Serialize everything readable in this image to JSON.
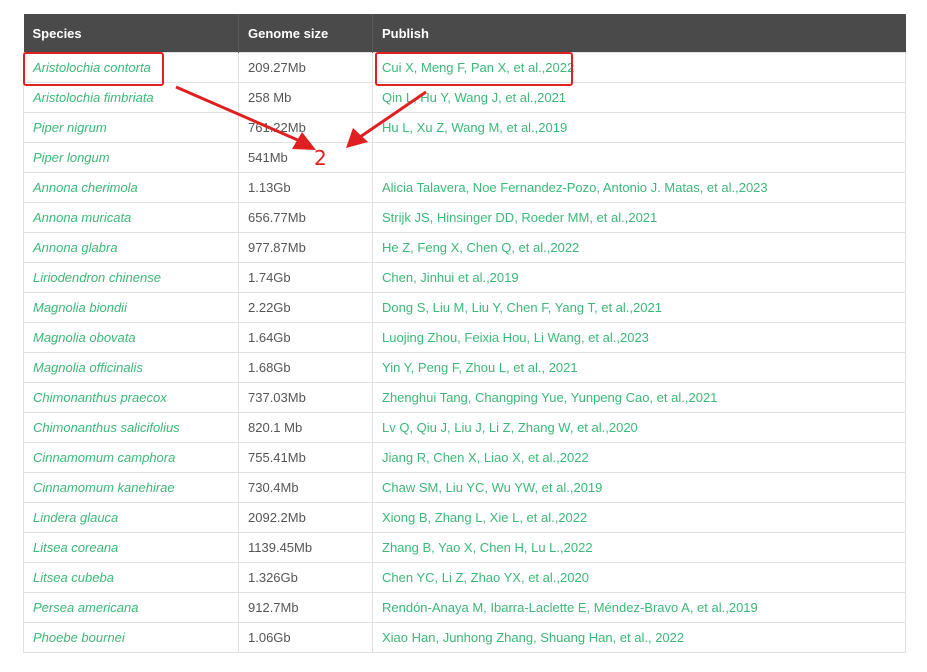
{
  "table": {
    "headers": [
      "Species",
      "Genome size",
      "Publish"
    ],
    "rows": [
      {
        "species": "Aristolochia contorta",
        "size": "209.27Mb",
        "publish": "Cui X, Meng F, Pan X, et al.,2022"
      },
      {
        "species": "Aristolochia fimbriata",
        "size": "258 Mb",
        "publish": "Qin L, Hu Y, Wang J, et al.,2021"
      },
      {
        "species": "Piper nigrum",
        "size": "761.22Mb",
        "publish": "Hu L, Xu Z, Wang M, et al.,2019"
      },
      {
        "species": "Piper longum",
        "size": "541Mb",
        "publish": ""
      },
      {
        "species": "Annona cherimola",
        "size": "1.13Gb",
        "publish": "Alicia Talavera, Noe Fernandez-Pozo, Antonio J. Matas, et al.,2023"
      },
      {
        "species": "Annona muricata",
        "size": "656.77Mb",
        "publish": "Strijk JS, Hinsinger DD, Roeder MM, et al.,2021"
      },
      {
        "species": "Annona glabra",
        "size": "977.87Mb",
        "publish": "He Z, Feng X, Chen Q, et al.,2022"
      },
      {
        "species": "Liriodendron chinense",
        "size": "1.74Gb",
        "publish": "Chen, Jinhui et al.,2019"
      },
      {
        "species": "Magnolia biondii",
        "size": "2.22Gb",
        "publish": "Dong S, Liu M, Liu Y, Chen F, Yang T, et al.,2021"
      },
      {
        "species": "Magnolia obovata",
        "size": "1.64Gb",
        "publish": "Luojing Zhou, Feixia Hou, Li Wang, et al.,2023"
      },
      {
        "species": "Magnolia officinalis",
        "size": "1.68Gb",
        "publish": "Yin Y, Peng F, Zhou L, et al., 2021"
      },
      {
        "species": "Chimonanthus praecox",
        "size": "737.03Mb",
        "publish": "Zhenghui Tang, Changping Yue, Yunpeng Cao, et al.,2021"
      },
      {
        "species": "Chimonanthus salicifolius",
        "size": "820.1 Mb",
        "publish": "Lv Q, Qiu J, Liu J, Li Z, Zhang W, et al.,2020"
      },
      {
        "species": "Cinnamomum camphora",
        "size": "755.41Mb",
        "publish": "Jiang R, Chen X, Liao X, et al.,2022"
      },
      {
        "species": "Cinnamomum kanehirae",
        "size": "730.4Mb",
        "publish": "Chaw SM, Liu YC, Wu YW, et al.,2019"
      },
      {
        "species": "Lindera glauca",
        "size": "2092.2Mb",
        "publish": "Xiong B, Zhang L, Xie L, et al.,2022"
      },
      {
        "species": "Litsea coreana",
        "size": "1139.45Mb",
        "publish": "Zhang B, Yao X, Chen H, Lu L.,2022"
      },
      {
        "species": "Litsea cubeba",
        "size": "1.326Gb",
        "publish": "Chen YC, Li Z, Zhao YX, et al.,2020"
      },
      {
        "species": "Persea americana",
        "size": "912.7Mb",
        "publish": "Rendón-Anaya M, Ibarra-Laclette E, Méndez-Bravo A, et al.,2019"
      },
      {
        "species": "Phoebe bournei",
        "size": "1.06Gb",
        "publish": "Xiao Han, Junhong Zhang, Shuang Han, et al., 2022"
      }
    ]
  },
  "annotation": {
    "label": "2",
    "color": "#e02020"
  },
  "colors": {
    "header_bg": "#4a4a4a",
    "link": "#3cb878",
    "text": "#555555"
  }
}
